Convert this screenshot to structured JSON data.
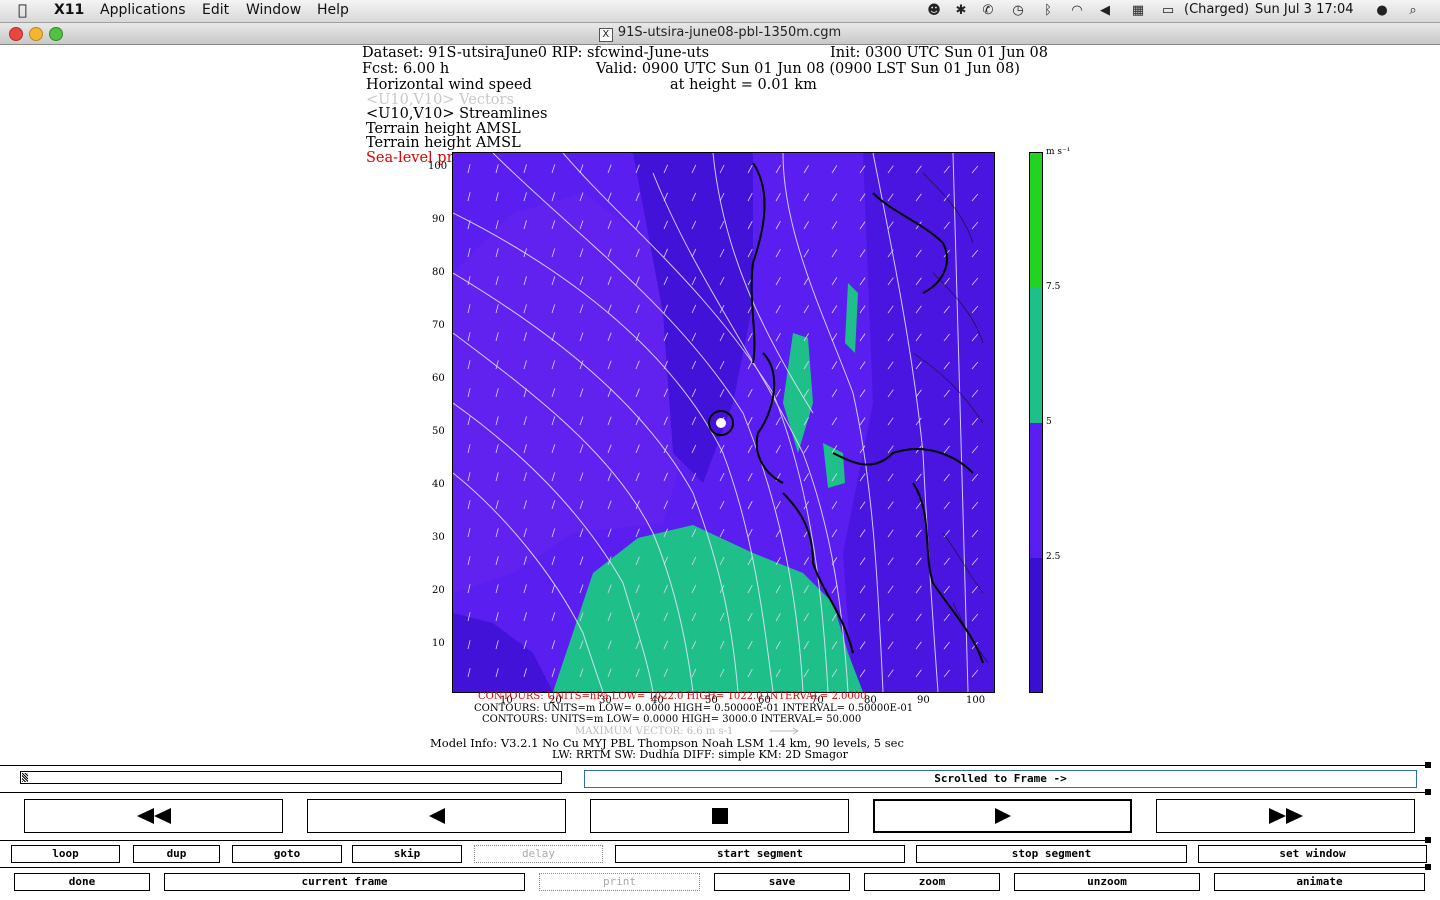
{
  "menubar": {
    "app": "X11",
    "items": [
      "Applications",
      "Edit",
      "Window",
      "Help"
    ],
    "battery": "(Charged)",
    "clock": "Sun Jul 3  17:04"
  },
  "window": {
    "title": "91S-utsira-june08-pbl-1350m.cgm"
  },
  "plot_header": {
    "dataset": "Dataset: 91S-utsiraJune0   RIP: sfcwind-June-uts",
    "init": "Init: 0300 UTC Sun 01 Jun 08",
    "fcst": "Fcst:    6.00 h",
    "valid": "Valid: 0900 UTC Sun 01 Jun 08 (0900 LST Sun 01 Jun 08)",
    "field1": "Horizontal wind speed",
    "height": "at height =  0.01 km",
    "field2": "<U10,V10> Vectors",
    "field3": "<U10,V10> Streamlines",
    "field4": "Terrain height AMSL",
    "field5": "Terrain height AMSL",
    "field6": "Sea-level pressure"
  },
  "colorbar": {
    "units": "m s⁻¹",
    "labels": [
      "7.5",
      "5",
      "2.5"
    ],
    "colors": [
      "#22d322",
      "#1fbf8a",
      "#5a1ff0",
      "#3a10d0"
    ]
  },
  "axes": {
    "y_ticks": [
      "100",
      "90",
      "80",
      "70",
      "60",
      "50",
      "40",
      "30",
      "20",
      "10"
    ],
    "x_ticks": [
      "10",
      "20",
      "30",
      "40",
      "50",
      "60",
      "70",
      "80",
      "90",
      "100"
    ]
  },
  "footer": {
    "c1": "CONTOURS:  UNITS=hPa   LOW=   1022.0         HIGH=   1022.0      INTERVAL=   2.0000",
    "c2": "CONTOURS:  UNITS=m   LOW=   0.0000          HIGH=  0.50000E-01  INTERVAL=  0.50000E-01",
    "c3": "CONTOURS:  UNITS=m   LOW=  0.0000          HIGH=   3000.0       INTERVAL=   50.000",
    "maxvec": "MAXIMUM VECTOR:   6.6 m s-1",
    "model1": "Model Info: V3.2.1     No Cu     MYJ PBL   Thompson        Noah LSM   1.4 km,   90 levels,     5 sec",
    "model2": "LW: RRTM  SW: Dudhia   DIFF: simple  KM: 2D Smagor"
  },
  "controls": {
    "status": "Scrolled to Frame ->",
    "row1": [
      "loop",
      "dup",
      "goto",
      "skip",
      "delay",
      "start segment",
      "stop segment",
      "set window"
    ],
    "row2": [
      "done",
      "current frame",
      "print",
      "save",
      "zoom",
      "unzoom",
      "animate"
    ]
  }
}
